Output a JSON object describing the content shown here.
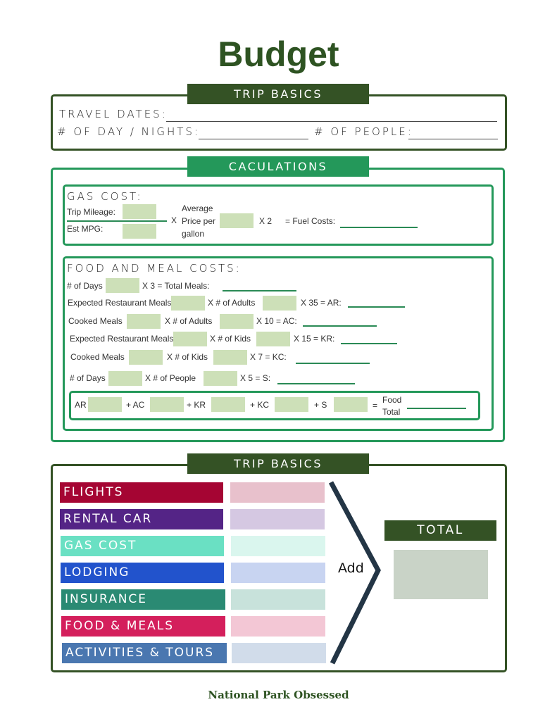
{
  "title": "Budget",
  "trip_basics": {
    "banner": "TRIP BASICS",
    "travel_dates_label": "TRAVEL DATES:",
    "days_nights_label": "# OF DAY / NIGHTS:",
    "people_label": "# OF PEOPLE:"
  },
  "calculations": {
    "banner": "CACULATIONS",
    "gas": {
      "heading": "GAS COST:",
      "trip_mileage": "Trip Mileage:",
      "est_mpg": "Est MPG:",
      "times1": "X",
      "avg_price_line1": "Average",
      "avg_price_line2": "Price per",
      "avg_price_line3": "gallon",
      "times2": "X  2",
      "fuel_costs": "=  Fuel Costs:"
    },
    "food": {
      "heading": "FOOD AND MEAL COSTS:",
      "rows": [
        {
          "label": "# of Days",
          "op1": "X  3   =  Total Meals:",
          "label2": "",
          "op2": ""
        },
        {
          "label": "Expected Restaurant Meals",
          "op1": "X  # of Adults",
          "op2": "X  35 =  AR:"
        },
        {
          "label": "Cooked Meals",
          "op1": "X  # of Adults",
          "op2": "X 10 =  AC:"
        },
        {
          "label": "Expected Restaurant Meals",
          "op1": "X  # of Kids",
          "op2": "X  15 =  KR:"
        },
        {
          "label": "Cooked Meals",
          "op1": "X  # of Kids",
          "op2": "X 7   =  KC:"
        },
        {
          "label": "# of Days",
          "op1": "X  # of People",
          "op2": "X 5  =  S:"
        }
      ],
      "sum": {
        "ar": "AR",
        "ac": "+ AC",
        "kr": "+ KR",
        "kc": "+ KC",
        "s": "+ S",
        "eq": "=",
        "food_total_1": "Food",
        "food_total_2": "Total"
      }
    }
  },
  "summary": {
    "banner": "TRIP BASICS",
    "categories": [
      {
        "label": "FLIGHTS",
        "color": "#a50533",
        "amount_color": "#e8c1cc"
      },
      {
        "label": "RENTAL CAR",
        "color": "#542486",
        "amount_color": "#d5c8e2"
      },
      {
        "label": "GAS COST",
        "color": "#6ae0c3",
        "amount_color": "#daf6ee"
      },
      {
        "label": "LODGING",
        "color": "#2253cc",
        "amount_color": "#c8d4f1"
      },
      {
        "label": "INSURANCE",
        "color": "#2a8a73",
        "amount_color": "#c8e2db"
      },
      {
        "label": "FOOD & MEALS",
        "color": "#d41f5c",
        "amount_color": "#f3c7d5"
      },
      {
        "label": "ACTIVITIES & TOURS",
        "color": "#4a77b0",
        "amount_color": "#d1dcea"
      }
    ],
    "add_label": "Add",
    "total_label": "TOTAL"
  },
  "footer": "National Park Obsessed"
}
